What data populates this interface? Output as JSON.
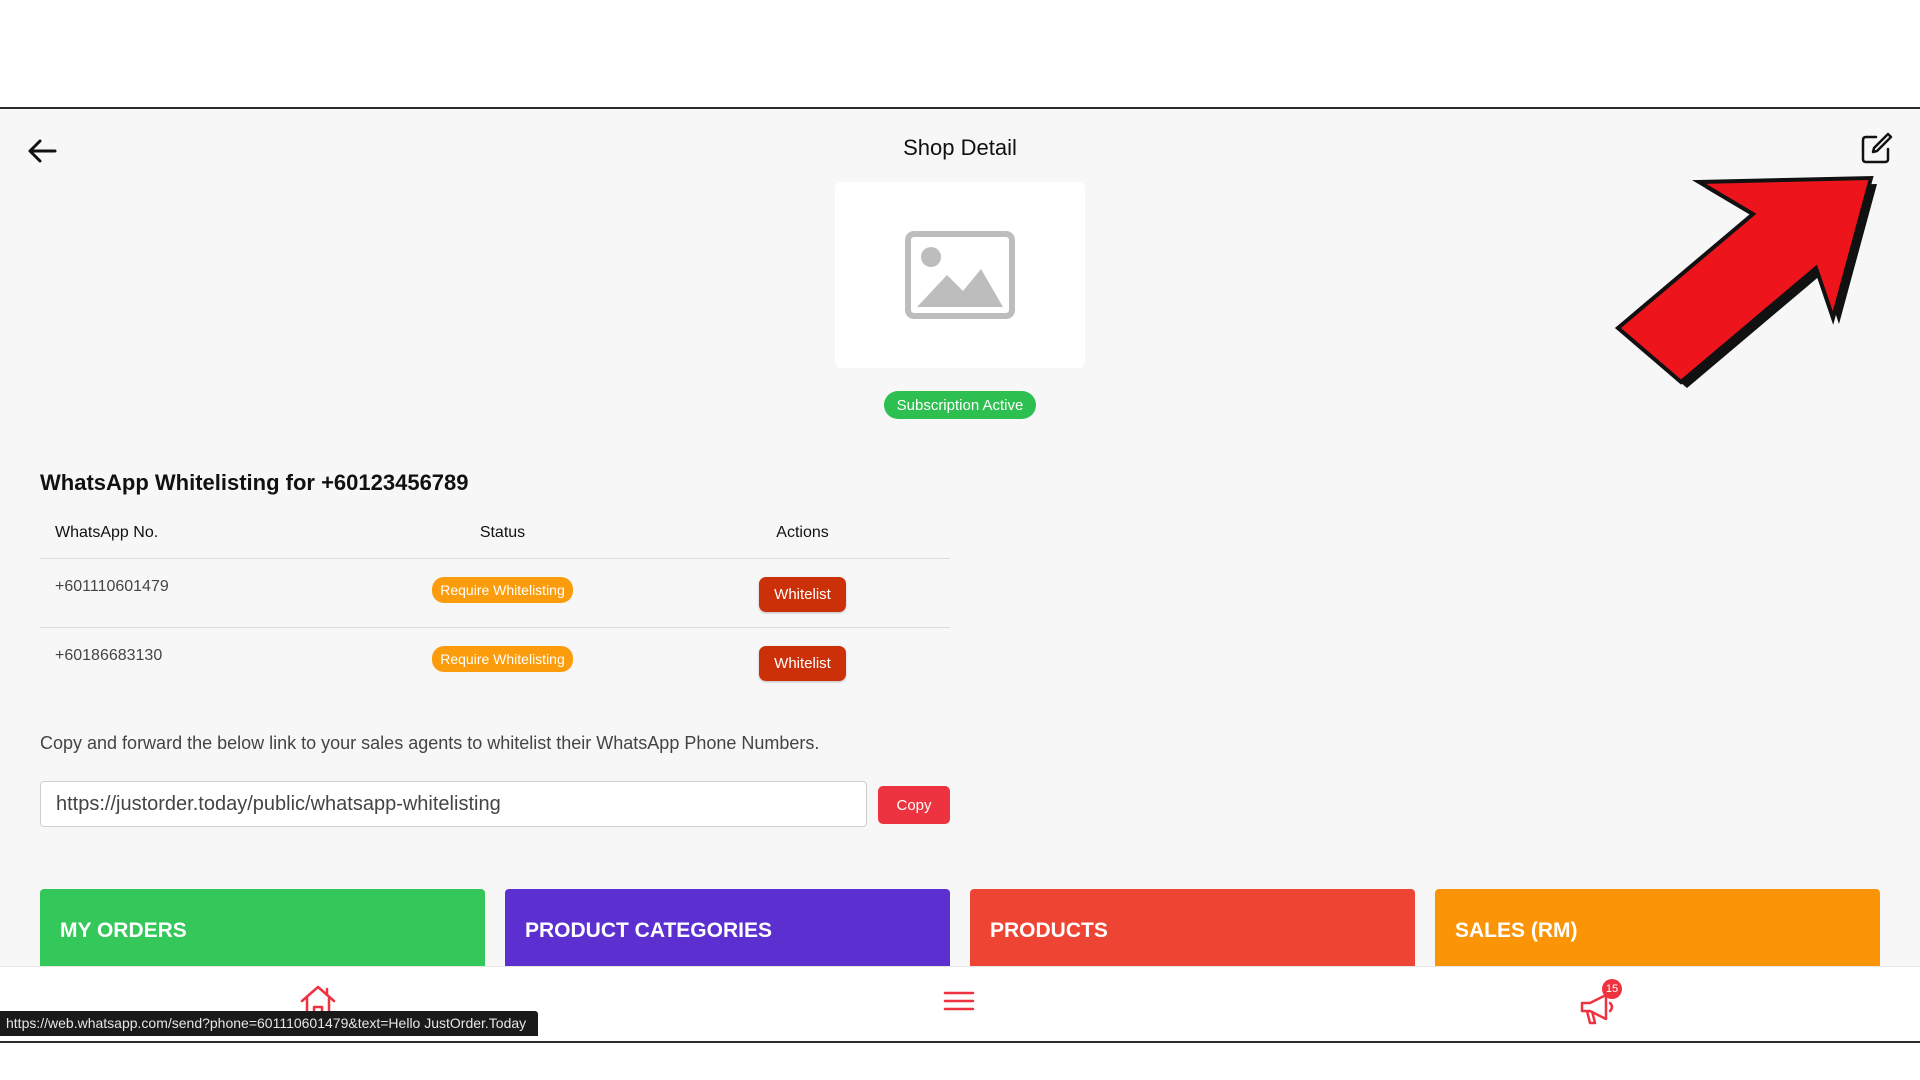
{
  "header": {
    "title": "Shop Detail",
    "back_icon": "arrow-left-icon",
    "edit_icon": "edit-square-icon"
  },
  "shop": {
    "image_icon": "image-placeholder-icon",
    "subscription_status": "Subscription Active"
  },
  "whitelisting": {
    "title": "WhatsApp Whitelisting for +60123456789",
    "columns": [
      "WhatsApp No.",
      "Status",
      "Actions"
    ],
    "rows": [
      {
        "number": "+601110601479",
        "status": "Require Whitelisting",
        "action": "Whitelist"
      },
      {
        "number": "+60186683130",
        "status": "Require Whitelisting",
        "action": "Whitelist"
      }
    ]
  },
  "share_link": {
    "instructions": "Copy and forward the below link to your sales agents to whitelist their WhatsApp Phone Numbers.",
    "url": "https://justorder.today/public/whatsapp-whitelisting",
    "copy_label": "Copy"
  },
  "tiles": [
    {
      "label": "MY ORDERS",
      "color": "#34c759"
    },
    {
      "label": "PRODUCT CATEGORIES",
      "color": "#5b2fd0"
    },
    {
      "label": "PRODUCTS",
      "color": "#ee4433"
    },
    {
      "label": "SALES (RM)",
      "color": "#fb9507"
    }
  ],
  "bottom_nav": {
    "home_icon": "home-icon",
    "menu_icon": "hamburger-menu-icon",
    "notifications_icon": "megaphone-icon",
    "notification_count": "15"
  },
  "status_bar": {
    "url": "https://web.whatsapp.com/send?phone=601110601479&text=Hello JustOrder.Today"
  },
  "colors": {
    "accent_red": "#ee3340",
    "subscription_green": "#2dbf50",
    "whitelist_red": "#cc3009",
    "status_orange": "#fb9c0c"
  }
}
